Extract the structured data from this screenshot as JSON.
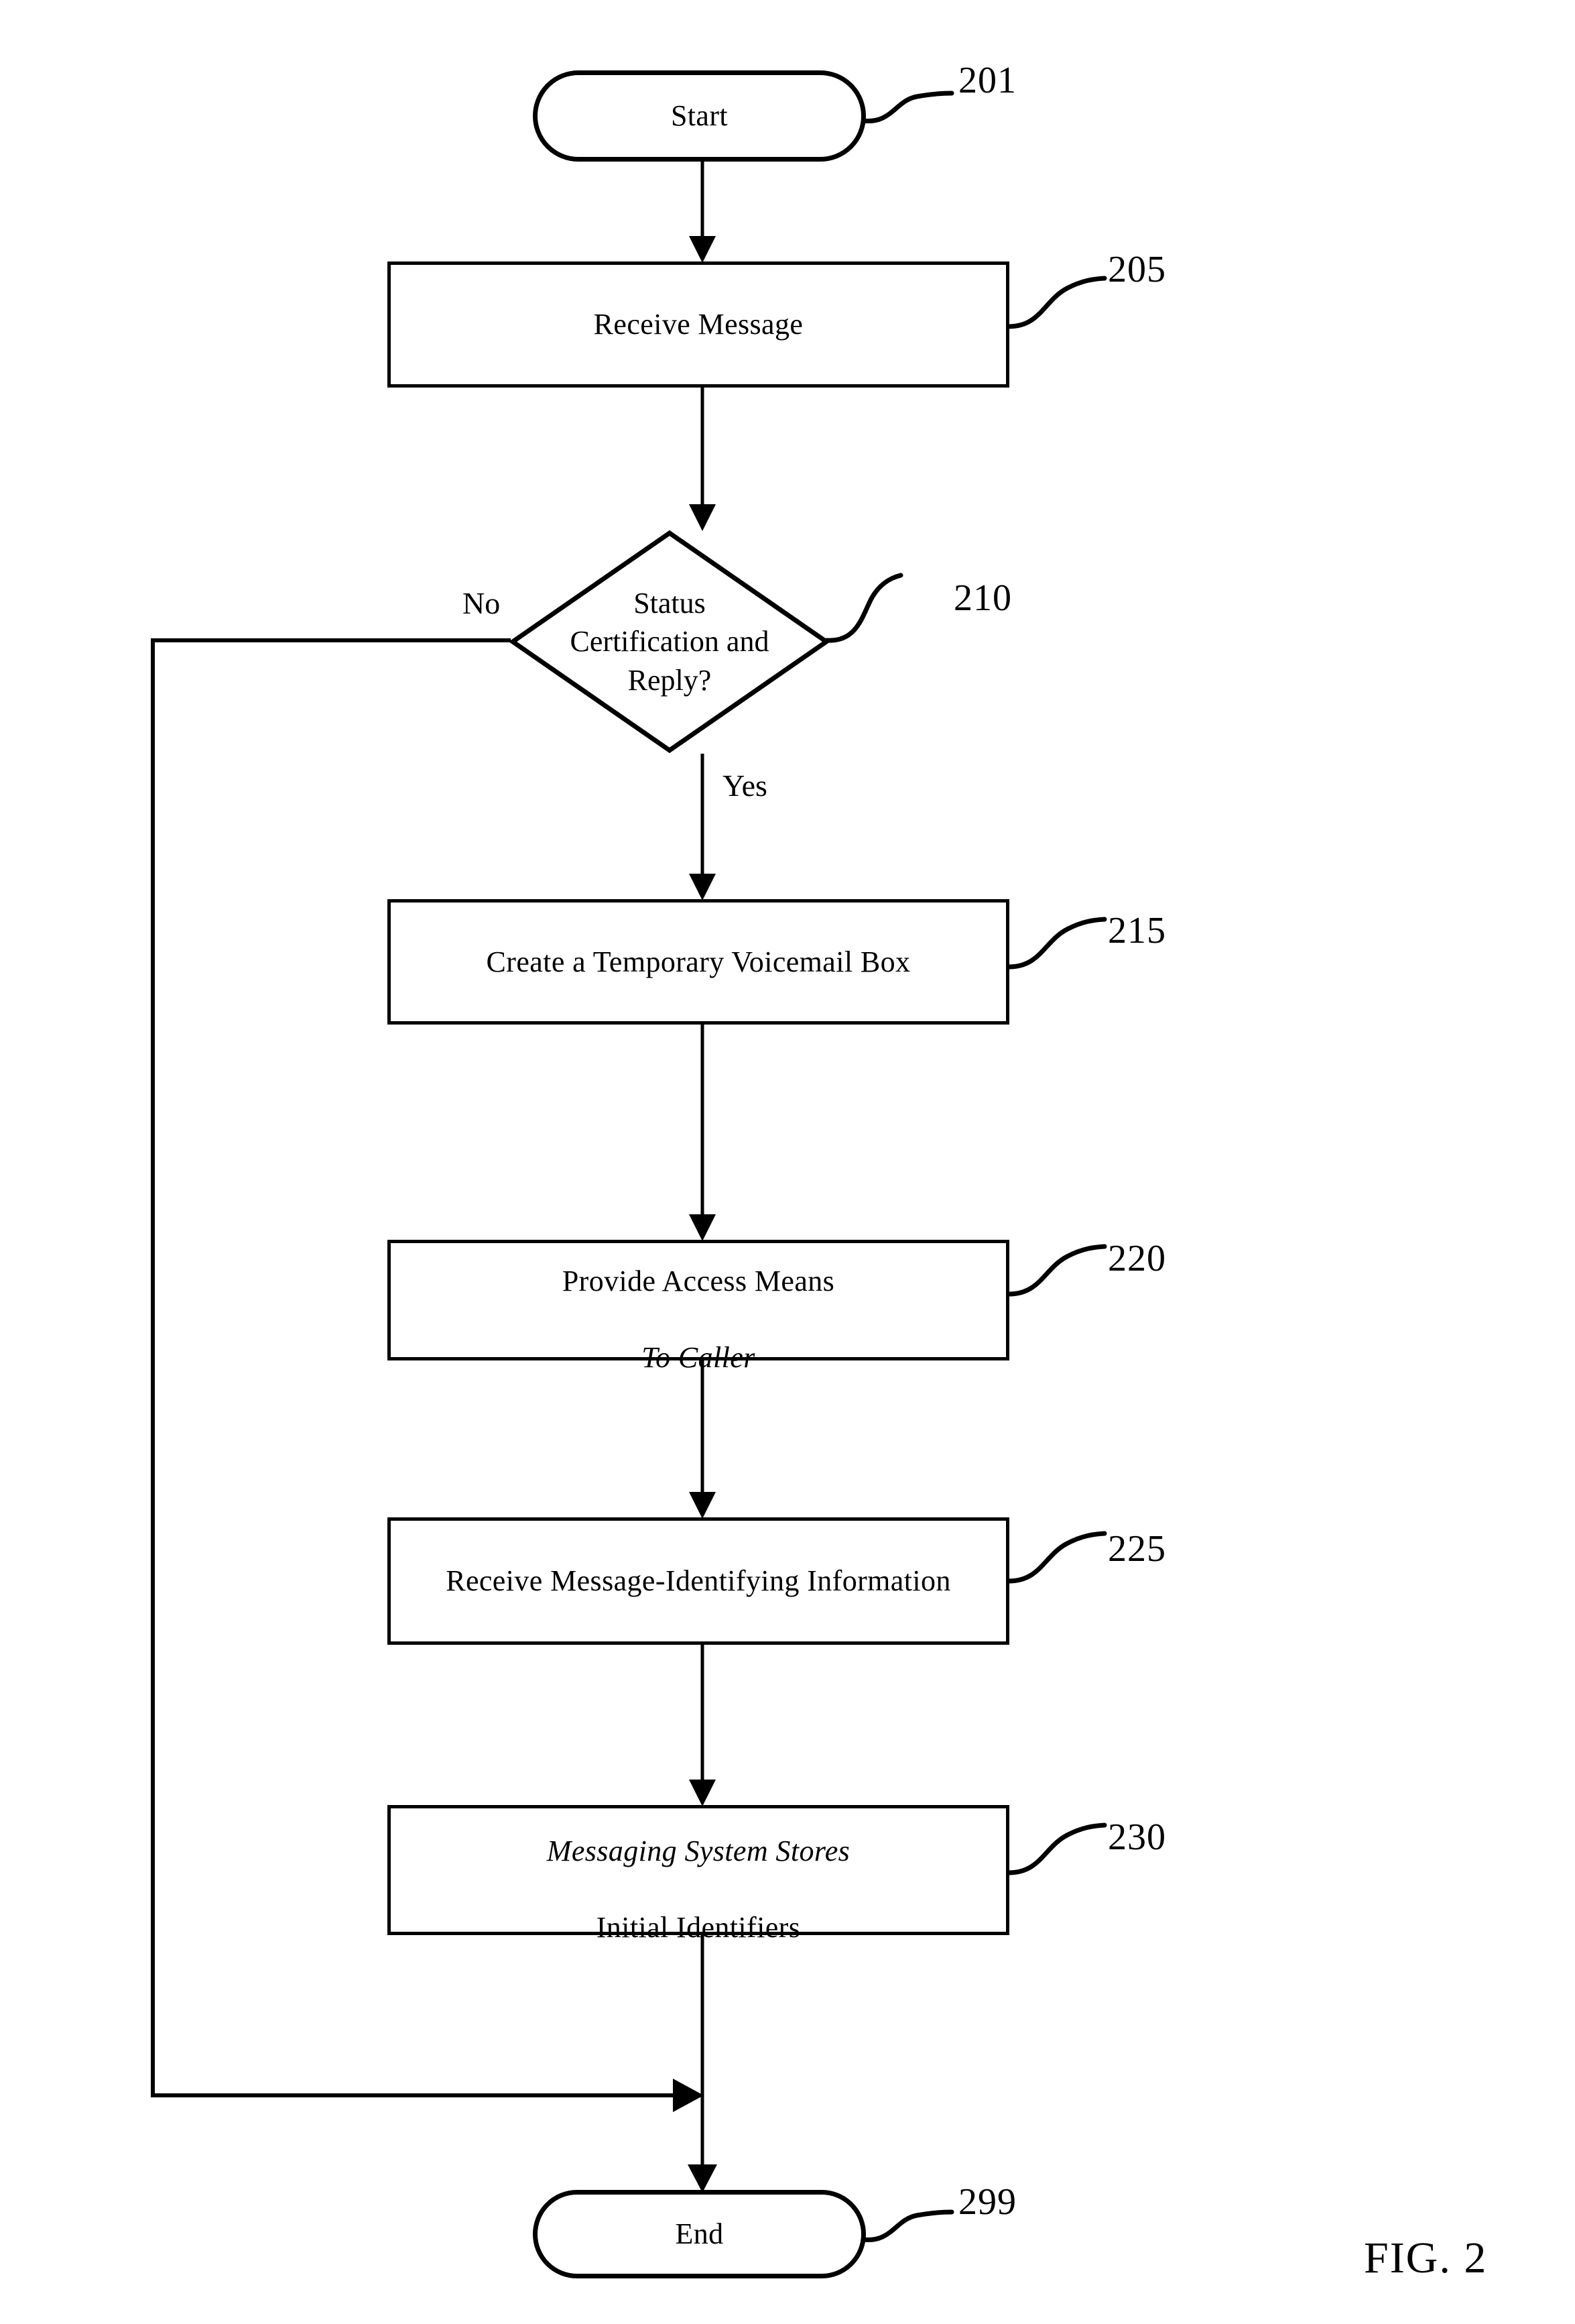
{
  "figure": {
    "caption": "FIG. 2",
    "type": "patent-flowchart"
  },
  "nodes": {
    "start": {
      "label": "Start",
      "ref": "201",
      "shape": "terminator"
    },
    "receive_message": {
      "label": "Receive Message",
      "ref": "205",
      "shape": "process"
    },
    "decision": {
      "label": "Status\nCertification and\nReply?",
      "ref": "210",
      "shape": "decision"
    },
    "create_box": {
      "label": "Create a Temporary Voicemail Box",
      "ref": "215",
      "shape": "process"
    },
    "provide_access": {
      "label_line1": "Provide Access Means",
      "label_line2": "To Caller",
      "ref": "220",
      "shape": "process"
    },
    "receive_info": {
      "label": "Receive Message-Identifying Information",
      "ref": "225",
      "shape": "process"
    },
    "store_identifiers": {
      "label_line1": "Messaging System Stores",
      "label_line2": "Initial Identifiers",
      "ref": "230",
      "shape": "process"
    },
    "end": {
      "label": "End",
      "ref": "299",
      "shape": "terminator"
    }
  },
  "branches": {
    "no": "No",
    "yes": "Yes"
  },
  "colors": {
    "ink": "#000000",
    "paper": "#ffffff"
  }
}
